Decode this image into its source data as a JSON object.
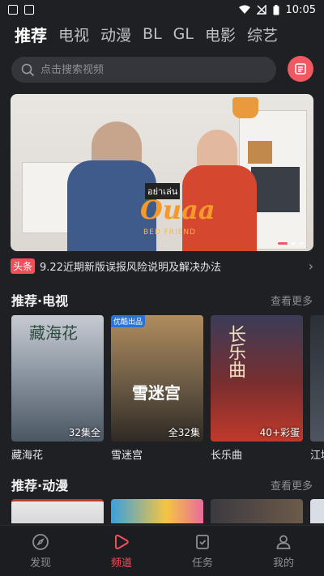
{
  "status_bar": {
    "time": "10:05"
  },
  "tabs": [
    {
      "label": "推荐",
      "active": true
    },
    {
      "label": "电视",
      "active": false
    },
    {
      "label": "动漫",
      "active": false
    },
    {
      "label": "BL",
      "active": false
    },
    {
      "label": "GL",
      "active": false
    },
    {
      "label": "电影",
      "active": false
    },
    {
      "label": "综艺",
      "active": false
    }
  ],
  "search": {
    "placeholder": "点击搜索视频"
  },
  "banner": {
    "badge": "อย่าเล่น",
    "logo": "Ouaa",
    "subtitle": "BED FRIEND",
    "active_slide": 1
  },
  "headline": {
    "badge": "头条",
    "text": "9.22近期新版误报风险说明及解决办法"
  },
  "section_tv": {
    "title": "推荐·电视",
    "more": "查看更多",
    "items": [
      {
        "name": "藏海花",
        "tag": "32集全",
        "corner": ""
      },
      {
        "name": "雪迷宫",
        "tag": "全32集",
        "corner": "优酷出品"
      },
      {
        "name": "长乐曲",
        "tag": "40+彩蛋",
        "corner": ""
      },
      {
        "name": "江城",
        "tag": "",
        "corner": ""
      }
    ]
  },
  "section_anime": {
    "title": "推荐·动漫",
    "more": "查看更多"
  },
  "bottom_nav": [
    {
      "label": "发现",
      "active": false
    },
    {
      "label": "频道",
      "active": true
    },
    {
      "label": "任务",
      "active": false
    },
    {
      "label": "我的",
      "active": false
    }
  ],
  "colors": {
    "accent": "#f0505a",
    "background": "#1f2024",
    "search_bg": "#35363b"
  }
}
